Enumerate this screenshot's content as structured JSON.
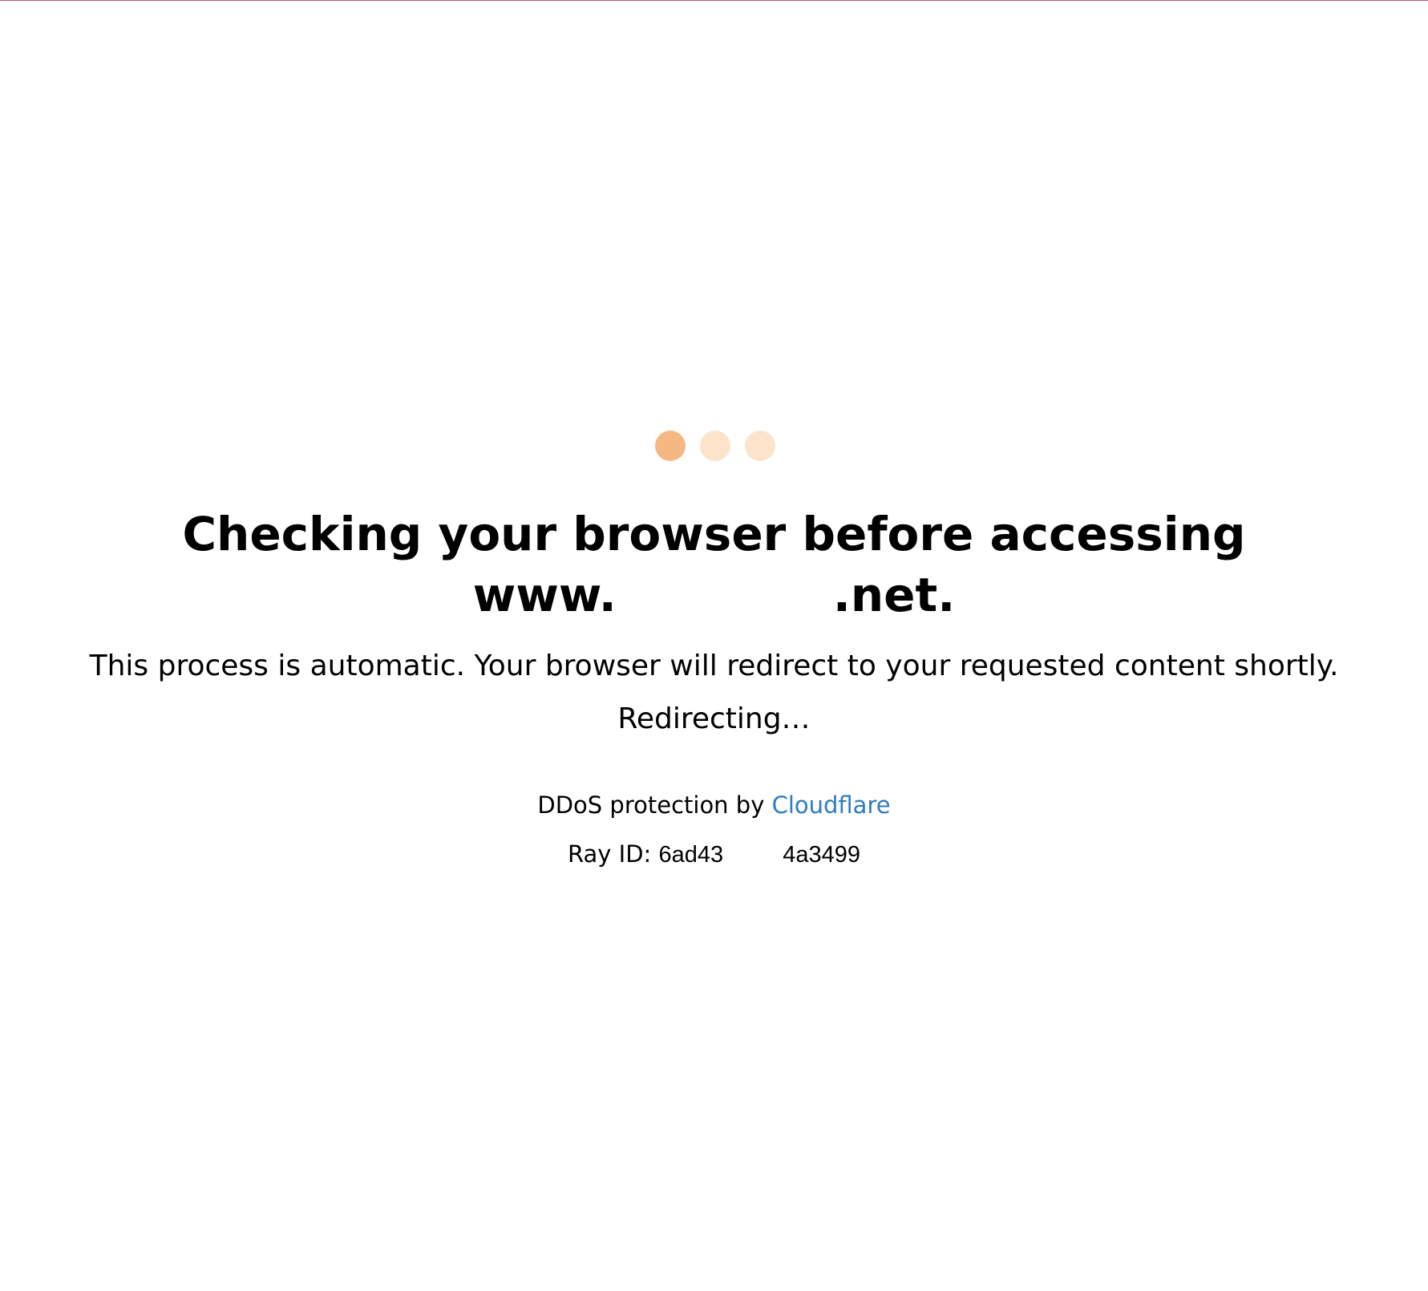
{
  "colors": {
    "dot_active": "#f6b883",
    "dot_inactive": "#fbe3cc",
    "link": "#2f7bbf",
    "top_border": "#c05a7a"
  },
  "loader": {
    "dots": [
      "dot-active",
      "dot-inactive",
      "dot-inactive"
    ]
  },
  "heading": {
    "line1": "Checking your browser before accessing",
    "domain_prefix": "www.",
    "domain_suffix": ".net."
  },
  "description": "This process is automatic. Your browser will redirect to your requested content shortly.",
  "status": "Redirecting…",
  "footer": {
    "protection_text": "DDoS protection by ",
    "link_label": "Cloudflare",
    "ray_label": "Ray ID: ",
    "ray_part1": "6ad43",
    "ray_part2": "4a3499"
  }
}
